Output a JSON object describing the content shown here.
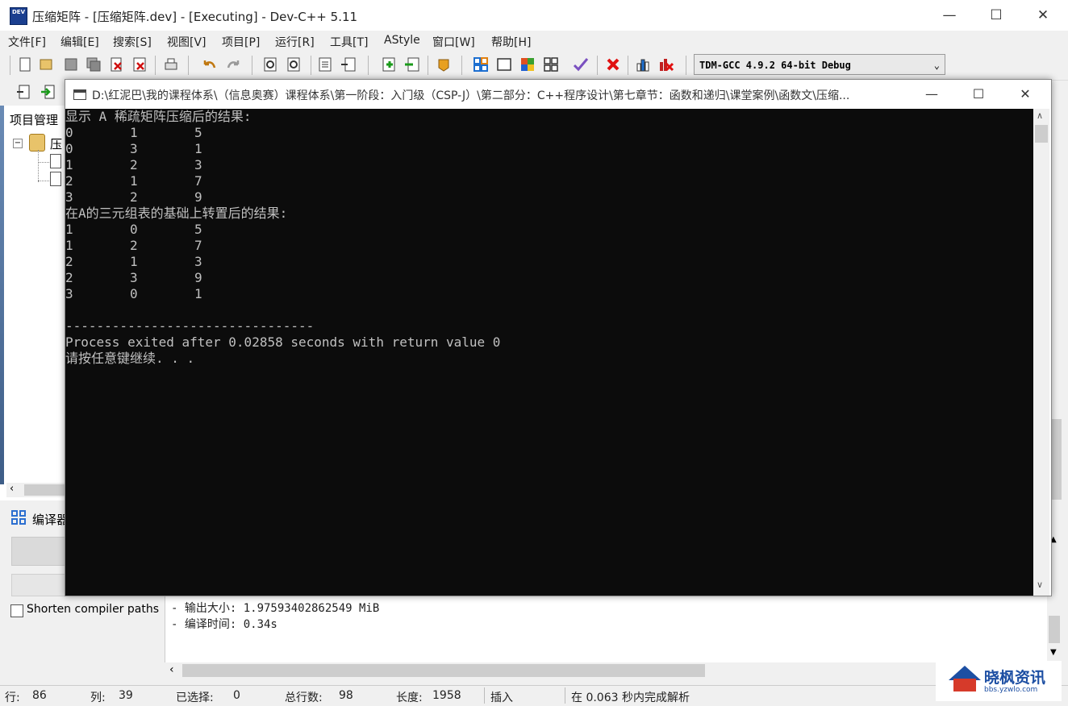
{
  "window": {
    "icon_text": "DEV",
    "title": "压缩矩阵 - [压缩矩阵.dev] - [Executing] - Dev-C++ 5.11",
    "minimize": "—",
    "maximize": "☐",
    "close": "✕"
  },
  "menu": [
    "文件[F]",
    "编辑[E]",
    "搜索[S]",
    "视图[V]",
    "项目[P]",
    "运行[R]",
    "工具[T]",
    "AStyle",
    "窗口[W]",
    "帮助[H]"
  ],
  "toolbar": {
    "compiler": "TDM-GCC 4.9.2 64-bit Debug",
    "compiler_chevron": "⌄"
  },
  "project_panel": {
    "label": "项目管理",
    "root_label": "压",
    "collapse_symbol": "−"
  },
  "bottom": {
    "compile_tab": "编译器",
    "shorten_paths": "Shorten compiler paths"
  },
  "log": [
    "- 输出大小: 1.97593402862549 MiB",
    "- 编译时间: 0.34s"
  ],
  "status": {
    "row_label": "行:",
    "row": "86",
    "col_label": "列:",
    "col": "39",
    "sel_label": "已选择:",
    "sel": "0",
    "lines_label": "总行数:",
    "lines": "98",
    "len_label": "长度:",
    "len": "1958",
    "mode": "插入",
    "parse": "在 0.063 秒内完成解析"
  },
  "watermark": {
    "title": "晓枫资讯",
    "sub": "bbs.yzwlo.com"
  },
  "console": {
    "path": "D:\\红泥巴\\我的课程体系\\（信息奥赛）课程体系\\第一阶段：入门级（CSP-J）\\第二部分：C++程序设计\\第七章节：函数和递归\\课堂案例\\函数文\\压缩...",
    "minimize": "—",
    "maximize": "☐",
    "close": "✕",
    "heading1": "显示 A 稀疏矩阵压缩后的结果:",
    "rows1": [
      [
        "0",
        "1",
        "5"
      ],
      [
        "0",
        "3",
        "1"
      ],
      [
        "1",
        "2",
        "3"
      ],
      [
        "2",
        "1",
        "7"
      ],
      [
        "3",
        "2",
        "9"
      ]
    ],
    "heading2": "在A的三元组表的基础上转置后的结果:",
    "rows2": [
      [
        "1",
        "0",
        "5"
      ],
      [
        "1",
        "2",
        "7"
      ],
      [
        "2",
        "1",
        "3"
      ],
      [
        "2",
        "3",
        "9"
      ],
      [
        "3",
        "0",
        "1"
      ]
    ],
    "divider": "--------------------------------",
    "exit_msg": "Process exited after 0.02858 seconds with return value 0",
    "continue_msg": "请按任意键继续. . ."
  }
}
